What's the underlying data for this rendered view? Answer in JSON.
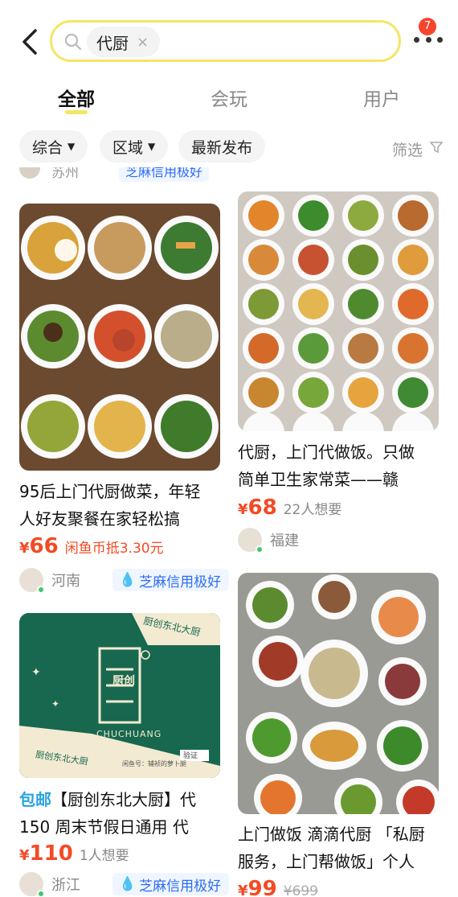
{
  "header": {
    "search_chip": "代厨",
    "notification_count": "7"
  },
  "tabs": [
    {
      "label": "全部",
      "active": true
    },
    {
      "label": "会玩",
      "active": false
    },
    {
      "label": "用户",
      "active": false
    }
  ],
  "filters": {
    "items": [
      "综合",
      "区域",
      "最新发布"
    ],
    "sift_label": "筛选"
  },
  "clipped_row": {
    "left_loc": "苏州",
    "right_credit": "芝麻信用极好"
  },
  "cards": [
    {
      "title_line1": "95后上门代厨做菜，年轻",
      "title_line2": "人好友聚餐在家轻松搞",
      "yen": "¥",
      "price": "66",
      "extra": "闲鱼币抵3.30元",
      "location": "河南",
      "credit": "芝麻信用极好"
    },
    {
      "title_line1": "代厨，上门代做饭。只做",
      "title_line2": "简单卫生家常菜——赣",
      "yen": "¥",
      "price": "68",
      "extra": "22人想要",
      "location": "福建"
    },
    {
      "title_prefix": "包邮",
      "title_line1": "【厨创东北大厨】代",
      "title_line2": "150  周末节假日通用 代",
      "yen": "¥",
      "price": "110",
      "extra": "1人想要",
      "location": "浙江",
      "credit": "芝麻信用极好",
      "banner": {
        "logo": "厨创",
        "brand": "CHUCHUANG",
        "diagonal_text": "厨创东北大厨",
        "corner_text": "闲鱼号：辅祯的萝卜腿",
        "stamp": "验证",
        "bg_color": "#17684f",
        "accent_color": "#f3ead2"
      }
    },
    {
      "title_line1": "上门做饭 滴滴代厨 「私厨",
      "title_line2": "服务，上门帮做饭」个人",
      "yen": "¥",
      "price": "99",
      "extra": "¥699"
    }
  ],
  "colors": {
    "accent_yellow": "#f5e663",
    "price_red": "#f34a25",
    "credit_blue": "#2d6df6",
    "online_green": "#3ec86b"
  }
}
